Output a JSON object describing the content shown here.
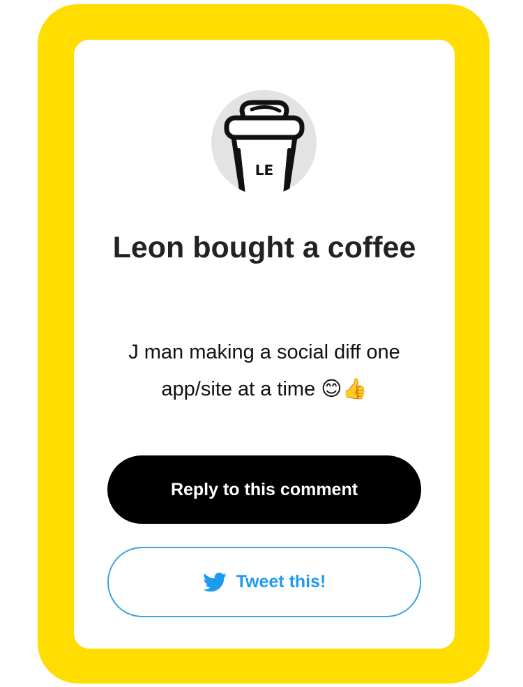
{
  "card": {
    "avatar_text": "LE",
    "title": "Leon bought a coffee",
    "message": "J man making a social diff one app/site at a time 😊👍"
  },
  "buttons": {
    "reply_label": "Reply to this comment",
    "tweet_label": "Tweet this!"
  },
  "icons": {
    "avatar": "coffee-cup-icon",
    "tweet": "twitter-bird-icon"
  },
  "colors": {
    "frame": "#ffdd00",
    "reply_button": "#000000",
    "tweet_accent": "#1d9bf0"
  }
}
